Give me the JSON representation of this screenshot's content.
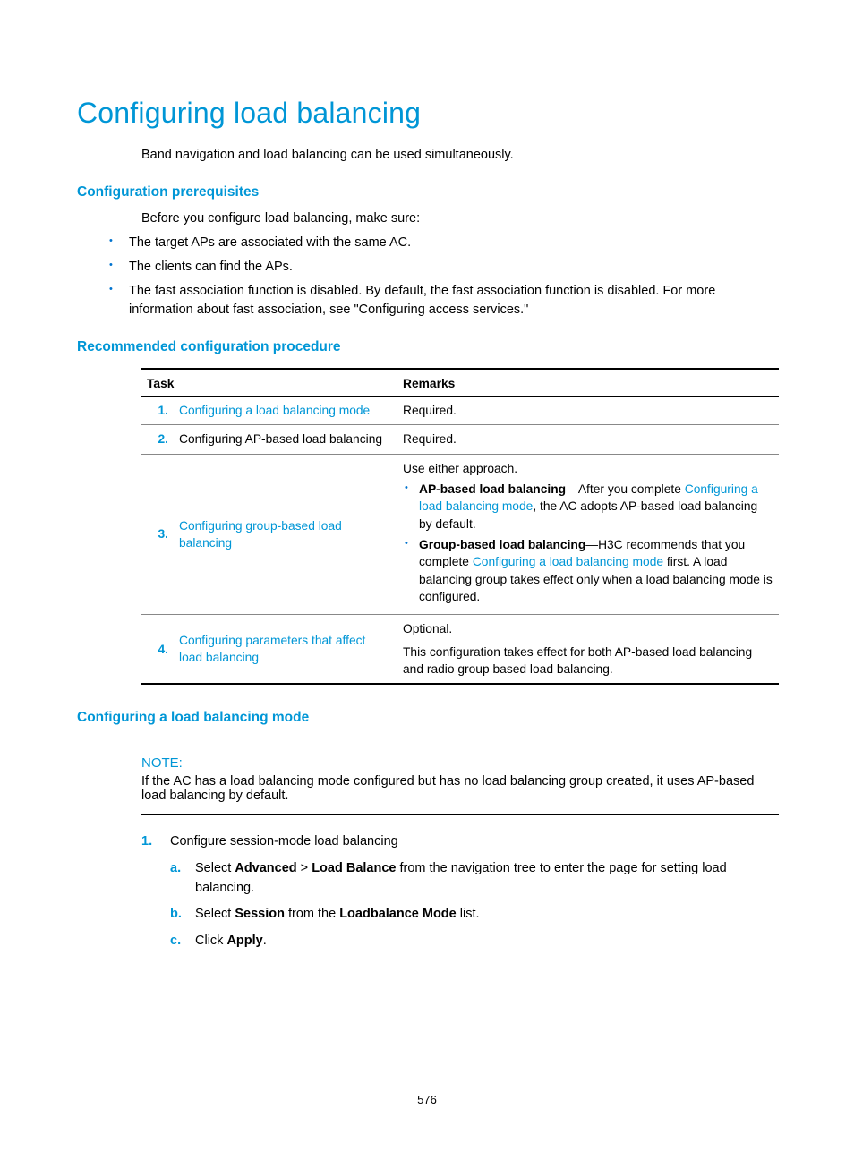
{
  "h1": "Configuring load balancing",
  "intro": "Band navigation and load balancing can be used simultaneously.",
  "sec_prereq_title": "Configuration prerequisites",
  "prereq_lead": "Before you configure load balancing, make sure:",
  "prereq": {
    "b1": "The target APs are associated with the same AC.",
    "b2": "The clients can find the APs.",
    "b3": "The fast association function is disabled. By default, the fast association function is disabled. For more information about fast association, see \"Configuring access services.\""
  },
  "sec_proc_title": "Recommended configuration procedure",
  "table": {
    "head_task": "Task",
    "head_remarks": "Remarks",
    "r1": {
      "num": "1.",
      "task": "Configuring a load balancing mode",
      "remark": "Required."
    },
    "r2": {
      "num": "2.",
      "task": "Configuring AP-based load balancing",
      "remark": "Required."
    },
    "r3": {
      "num": "3.",
      "task": "Configuring group-based load balancing",
      "lead": "Use either approach.",
      "ap_label": "AP-based load balancing",
      "ap_t1": "—After you complete ",
      "ap_link": "Configuring a load balancing mode",
      "ap_t2": ", the AC adopts AP-based load balancing by default.",
      "gp_label": "Group-based load balancing",
      "gp_t1": "—H3C recommends that you complete ",
      "gp_link": "Configuring a load balancing mode",
      "gp_t2": " first. A load balancing group takes effect only when a load balancing mode is configured."
    },
    "r4": {
      "num": "4.",
      "task": "Configuring parameters that affect load balancing",
      "l1": "Optional.",
      "l2": "This configuration takes effect for both AP-based load balancing and radio group based load balancing."
    }
  },
  "sec_mode_title": "Configuring a load balancing mode",
  "note_label": "NOTE:",
  "note_text": "If the AC has a load balancing mode configured but has no load balancing group created, it uses AP-based load balancing by default.",
  "steps": {
    "s1_num": "1.",
    "s1_text": "Configure session-mode load balancing",
    "a_let": "a.",
    "a_t1": "Select ",
    "a_b1": "Advanced",
    "a_gt": " > ",
    "a_b2": "Load Balance",
    "a_t2": " from the navigation tree to enter the page for setting load balancing.",
    "b_let": "b.",
    "b_t1": "Select ",
    "b_b1": "Session",
    "b_t2": " from the ",
    "b_b2": "Loadbalance Mode",
    "b_t3": " list.",
    "c_let": "c.",
    "c_t1": "Click ",
    "c_b1": "Apply",
    "c_t2": "."
  },
  "pagenum": "576"
}
